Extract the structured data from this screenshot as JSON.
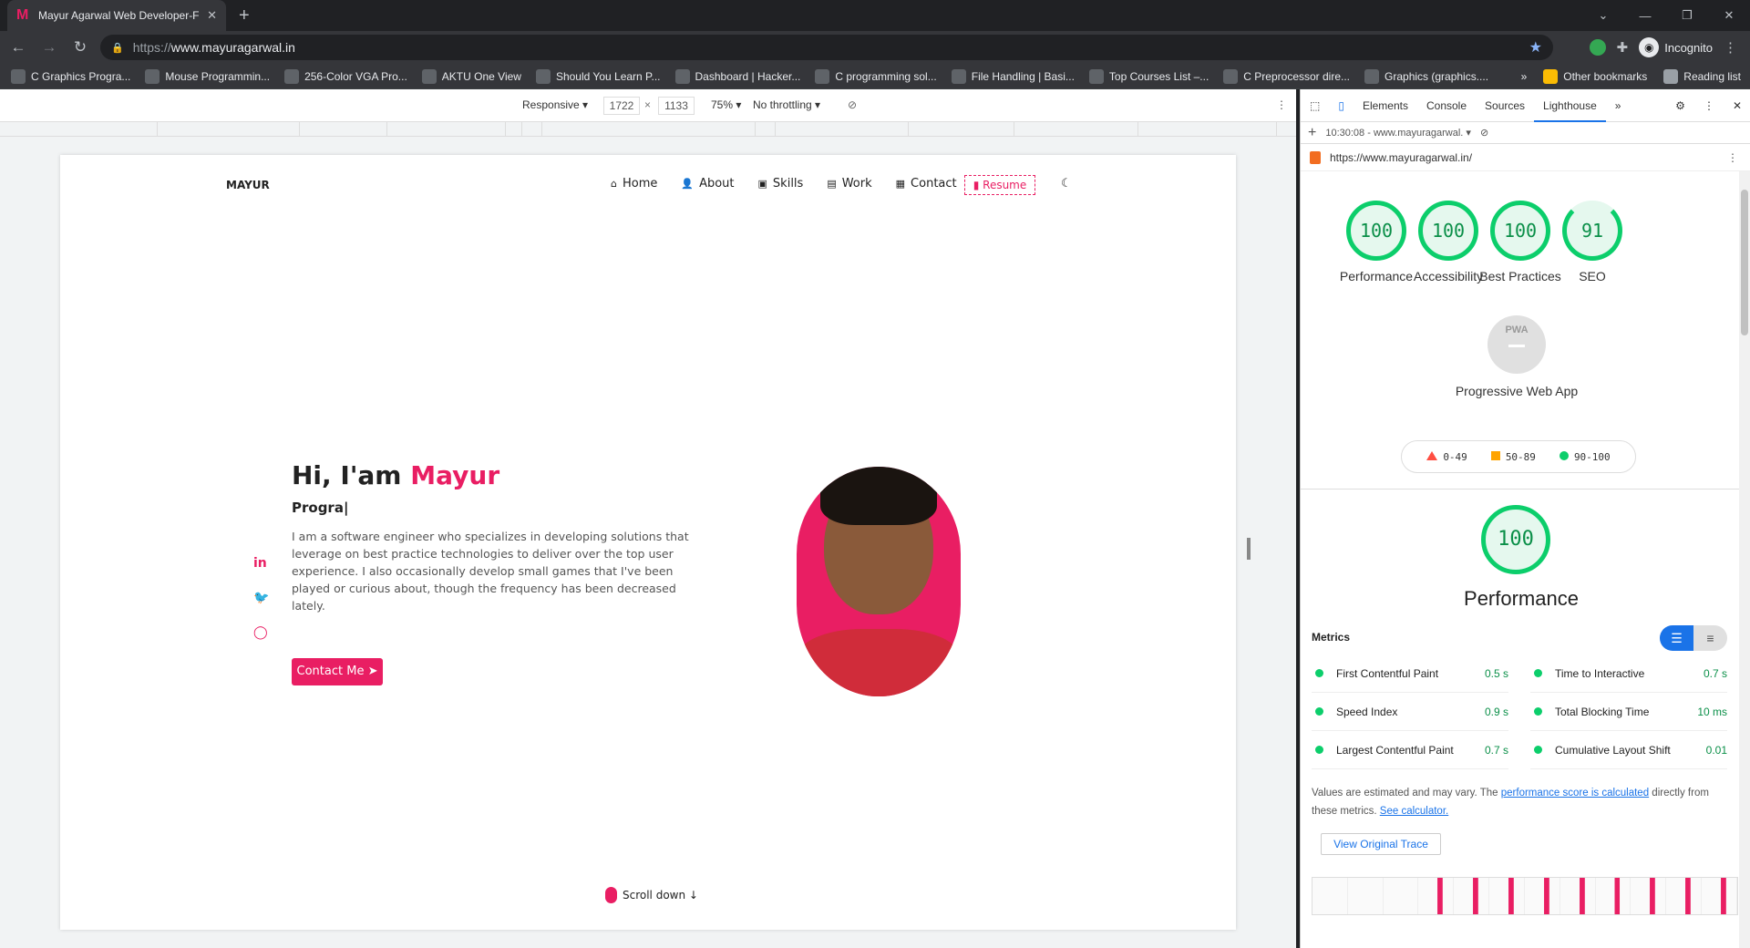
{
  "browser": {
    "tab_title": "Mayur Agarwal Web Developer-F",
    "url_scheme": "https://",
    "url_host": "www.mayuragarwal.in",
    "profile": "Incognito",
    "bookmarks": [
      "C Graphics Progra...",
      "Mouse Programmin...",
      "256-Color VGA Pro...",
      "AKTU One View",
      "Should You Learn P...",
      "Dashboard | Hacker...",
      "C programming sol...",
      "File Handling | Basi...",
      "Top Courses List –...",
      "C Preprocessor dire...",
      "Graphics (graphics...."
    ],
    "other_bookmarks": "Other bookmarks",
    "reading_list": "Reading list",
    "overflow": "»"
  },
  "device_toolbar": {
    "mode": "Responsive ▾",
    "width": "1722",
    "times": "×",
    "height": "1133",
    "zoom": "75% ▾",
    "throttle": "No throttling ▾"
  },
  "site": {
    "logo": "MAYUR",
    "nav": [
      "Home",
      "About",
      "Skills",
      "Work",
      "Contact"
    ],
    "resume": "Resume",
    "greeting": "Hi, I'am ",
    "name": "Mayur",
    "typed": "Progra|",
    "bio": "I am a software engineer who specializes in developing solutions that leverage on best practice technologies to deliver over the top user experience. I also occasionally develop small games that I've been played or curious about, though the frequency has been decreased lately.",
    "social": [
      "in",
      "🐦",
      "◯"
    ],
    "contact_btn": "Contact Me ➤",
    "scroll": "Scroll down ↓"
  },
  "devtools": {
    "tabs": [
      "Elements",
      "Console",
      "Sources",
      "Lighthouse",
      "»"
    ],
    "active_tab": "Lighthouse",
    "report_time": "10:30:08 - www.mayuragarwal. ▾",
    "report_url": "https://www.mayuragarwal.in/",
    "scores": [
      {
        "label": "Performance",
        "value": "100"
      },
      {
        "label": "Accessibility",
        "value": "100"
      },
      {
        "label": "Best Practices",
        "value": "100"
      },
      {
        "label": "SEO",
        "value": "91"
      }
    ],
    "pwa_label": "Progressive Web App",
    "pwa_badge": "PWA",
    "legend": [
      "0-49",
      "50-89",
      "90-100"
    ],
    "perf_score": "100",
    "perf_title": "Performance",
    "metrics_heading": "Metrics",
    "metrics": [
      {
        "name": "First Contentful Paint",
        "value": "0.5 s"
      },
      {
        "name": "Time to Interactive",
        "value": "0.7 s"
      },
      {
        "name": "Speed Index",
        "value": "0.9 s"
      },
      {
        "name": "Total Blocking Time",
        "value": "10 ms"
      },
      {
        "name": "Largest Contentful Paint",
        "value": "0.7 s"
      },
      {
        "name": "Cumulative Layout Shift",
        "value": "0.01"
      }
    ],
    "note_pre": "Values are estimated and may vary. The ",
    "note_link1": "performance score is calculated",
    "note_mid": " directly from these metrics. ",
    "note_link2": "See calculator.",
    "trace_btn": "View Original Trace",
    "colors": {
      "pass": "#0cce6b",
      "average": "#ffa400",
      "fail": "#ff4e42",
      "accent": "#e91e63"
    }
  }
}
